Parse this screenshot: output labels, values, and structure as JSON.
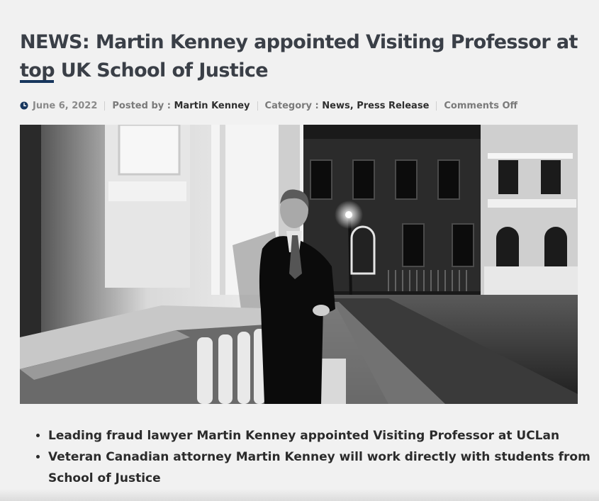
{
  "article": {
    "title": "NEWS: Martin Kenney appointed Visiting Professor at top UK School of Justice",
    "meta": {
      "date": "June 6, 2022",
      "posted_by_label": "Posted by :",
      "author": "Martin Kenney",
      "category_label": "Category :",
      "categories": [
        "News",
        "Press Release"
      ],
      "comments": "Comments Off"
    },
    "image": {
      "icon": "photo",
      "description_hidden": ""
    },
    "bullets": [
      "Leading fraud lawyer Martin Kenney appointed Visiting Professor at UCLan",
      "Veteran Canadian attorney Martin Kenney will work directly with students from School of Justice"
    ]
  },
  "colors": {
    "accent": "#17365d",
    "title": "#3a3f47",
    "background": "#f1f1f1"
  }
}
